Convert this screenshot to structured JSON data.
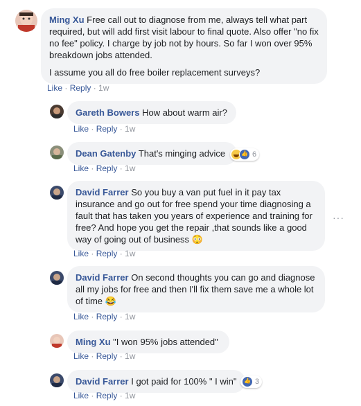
{
  "comments": [
    {
      "author": "Ming Xu",
      "text": "Free call out to diagnose from me, always tell what part required, but will add first visit labour to final quote. Also offer \"no fix no fee\" policy. I charge by job not by hours. So far I won over 95% breakdown jobs attended.",
      "text2": "I assume you all do free boiler replacement surveys?",
      "like": "Like",
      "reply": "Reply",
      "time": "1w"
    },
    {
      "author": "Gareth Bowers",
      "text": "How about warm air?",
      "like": "Like",
      "reply": "Reply",
      "time": "1w"
    },
    {
      "author": "Dean Gatenby",
      "text": "That's minging advice",
      "reactions": "6",
      "like": "Like",
      "reply": "Reply",
      "time": "1w"
    },
    {
      "author": "David Farrer",
      "text": "So you buy a van put fuel in it pay tax insurance and go out for free spend your time diagnosing a fault that has taken you years of experience and training for free? And hope you get the repair ,that sounds like a good way of going out of business 😳",
      "like": "Like",
      "reply": "Reply",
      "time": "1w"
    },
    {
      "author": "David Farrer",
      "text": "On second thoughts you can go and diagnose all my jobs for free and then I'll fix them save me a whole lot of time 😂",
      "like": "Like",
      "reply": "Reply",
      "time": "1w"
    },
    {
      "author": "Ming Xu",
      "text": "\"I won 95% jobs attended\"",
      "like": "Like",
      "reply": "Reply",
      "time": "1w"
    },
    {
      "author": "David Farrer",
      "text": "I got paid for 100% \" I win\"",
      "reactions": "3",
      "like": "Like",
      "reply": "Reply",
      "time": "1w"
    }
  ],
  "more_options": "···"
}
